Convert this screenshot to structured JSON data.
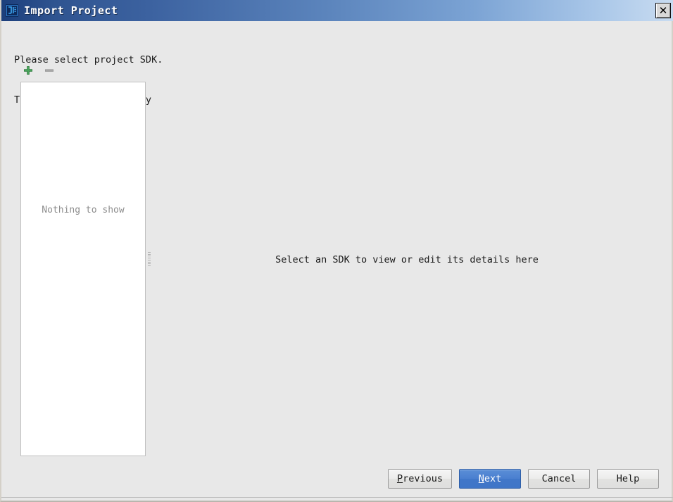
{
  "window": {
    "title": "Import Project",
    "icon": "intellij-logo-icon",
    "close_label": "✕",
    "background_color": "#e8e8e8",
    "titlebar_gradient_from": "#1c3f7c",
    "titlebar_gradient_to": "#c9dcf1"
  },
  "description": {
    "line1": "Please select project SDK.",
    "line2": "This SDK will be used by default by all project modules."
  },
  "toolbar": {
    "add_label": "+",
    "add_color": "#36a14a",
    "remove_label": "—",
    "remove_color": "#9e9e9e"
  },
  "sdk_list": {
    "empty_text": "Nothing to show",
    "empty_text_color": "#8d8d8d"
  },
  "detail": {
    "placeholder": "Select an SDK to view or edit its details here"
  },
  "buttons": {
    "previous": {
      "prefix": "",
      "mnemonic": "P",
      "suffix": "revious"
    },
    "next": {
      "prefix": "",
      "mnemonic": "N",
      "suffix": "ext",
      "accent": "#4a7fd0"
    },
    "cancel": {
      "label": "Cancel"
    },
    "help": {
      "label": "Help"
    }
  }
}
